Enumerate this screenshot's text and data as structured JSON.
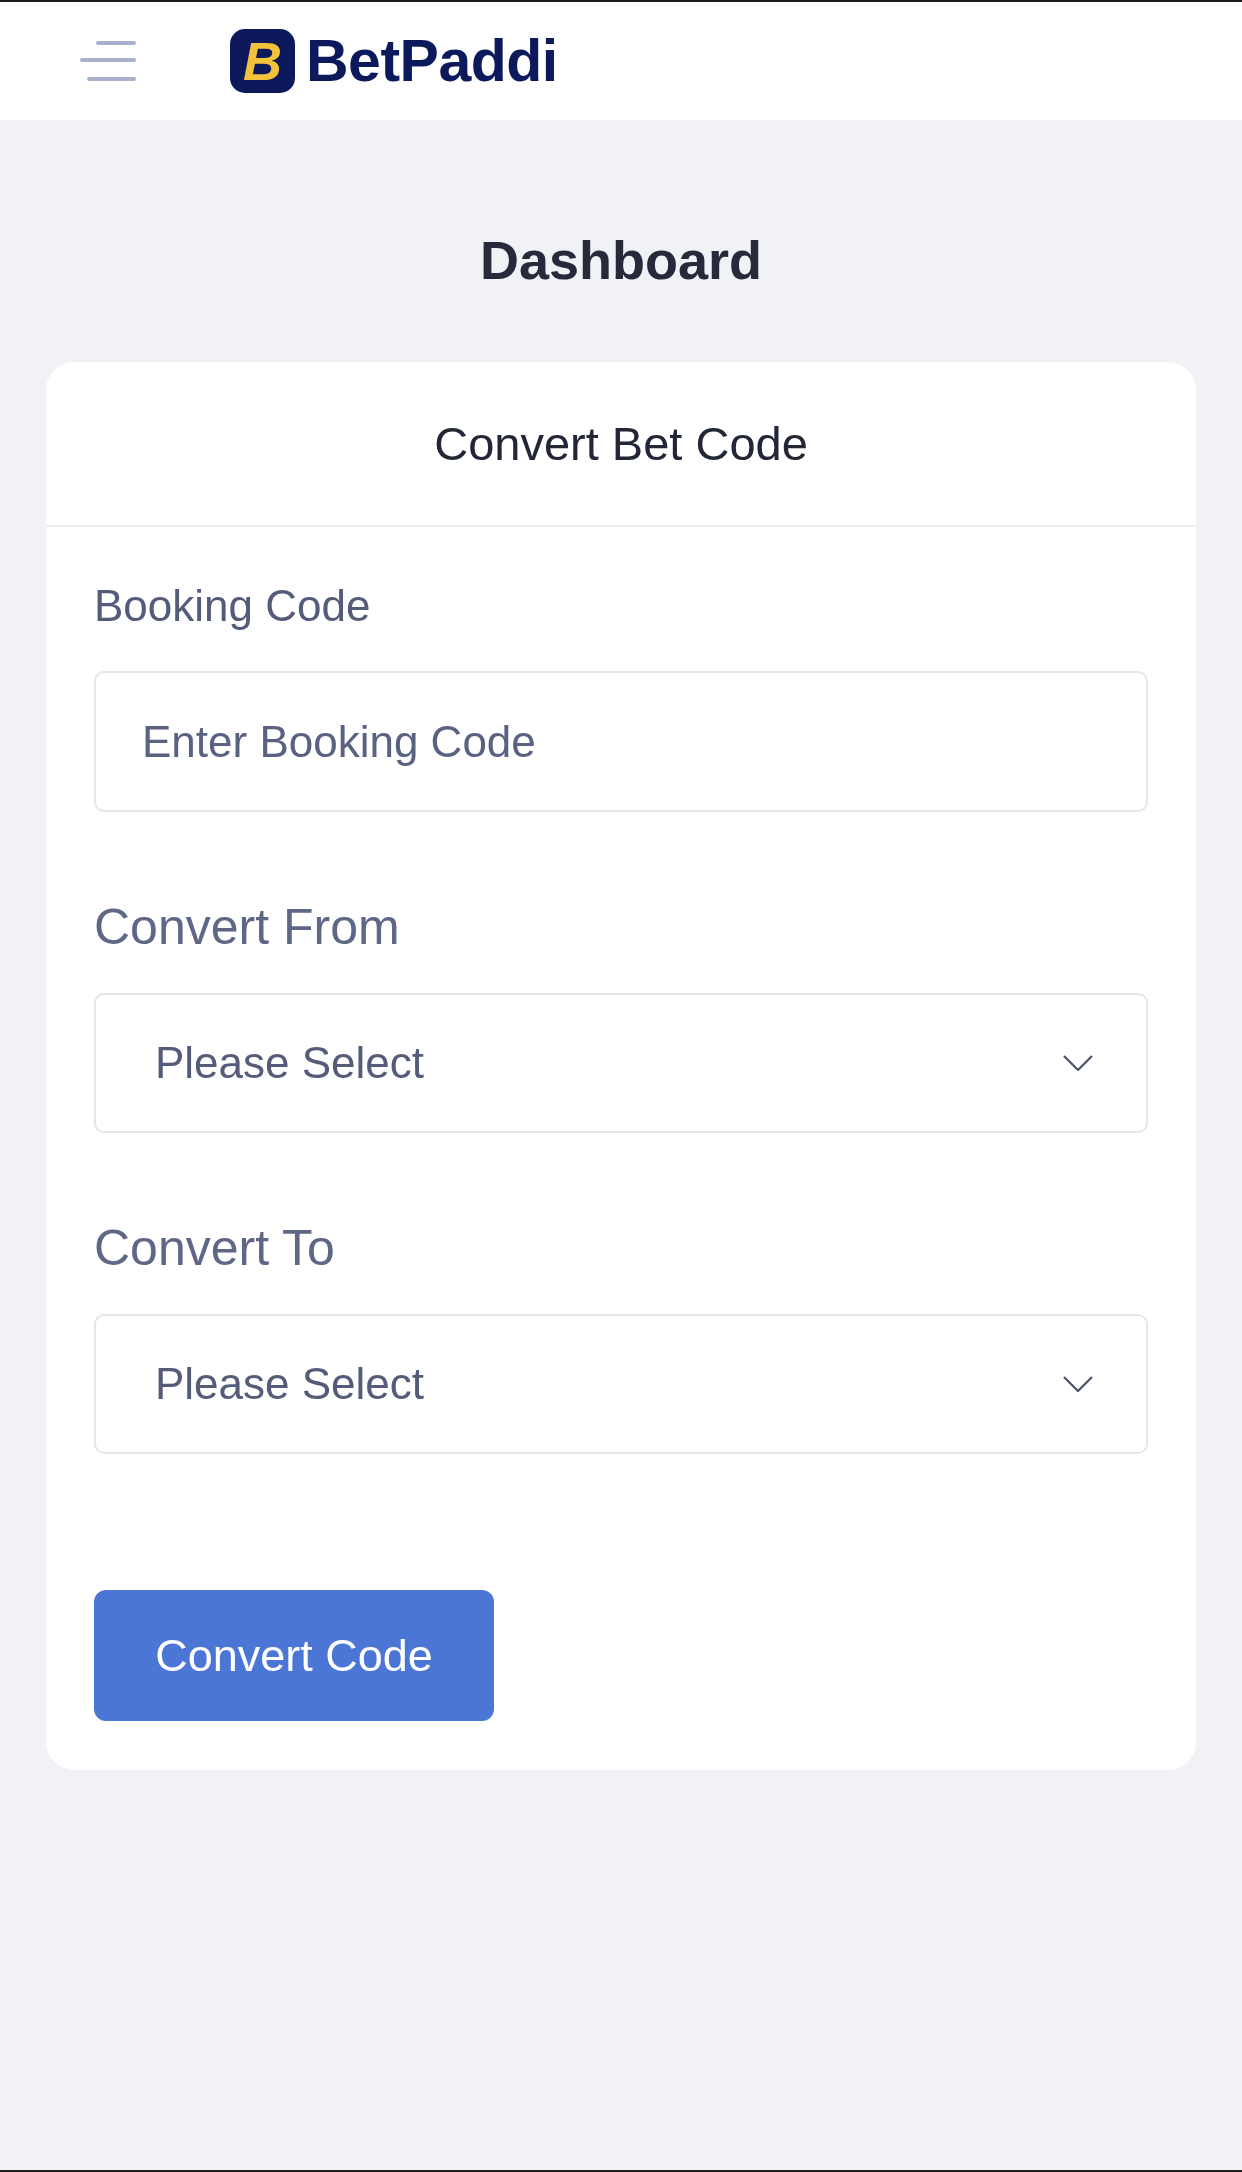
{
  "header": {
    "logo": {
      "mark": "B",
      "name": "BetPaddi"
    }
  },
  "page_title": "Dashboard",
  "card": {
    "title": "Convert Bet Code",
    "fields": [
      {
        "kind": "text",
        "label": "Booking Code",
        "placeholder": "Enter Booking Code"
      },
      {
        "kind": "select",
        "label": "Convert From",
        "placeholder": "Please Select"
      },
      {
        "kind": "select",
        "label": "Convert To",
        "placeholder": "Please Select"
      }
    ],
    "button": "Convert Code"
  }
}
